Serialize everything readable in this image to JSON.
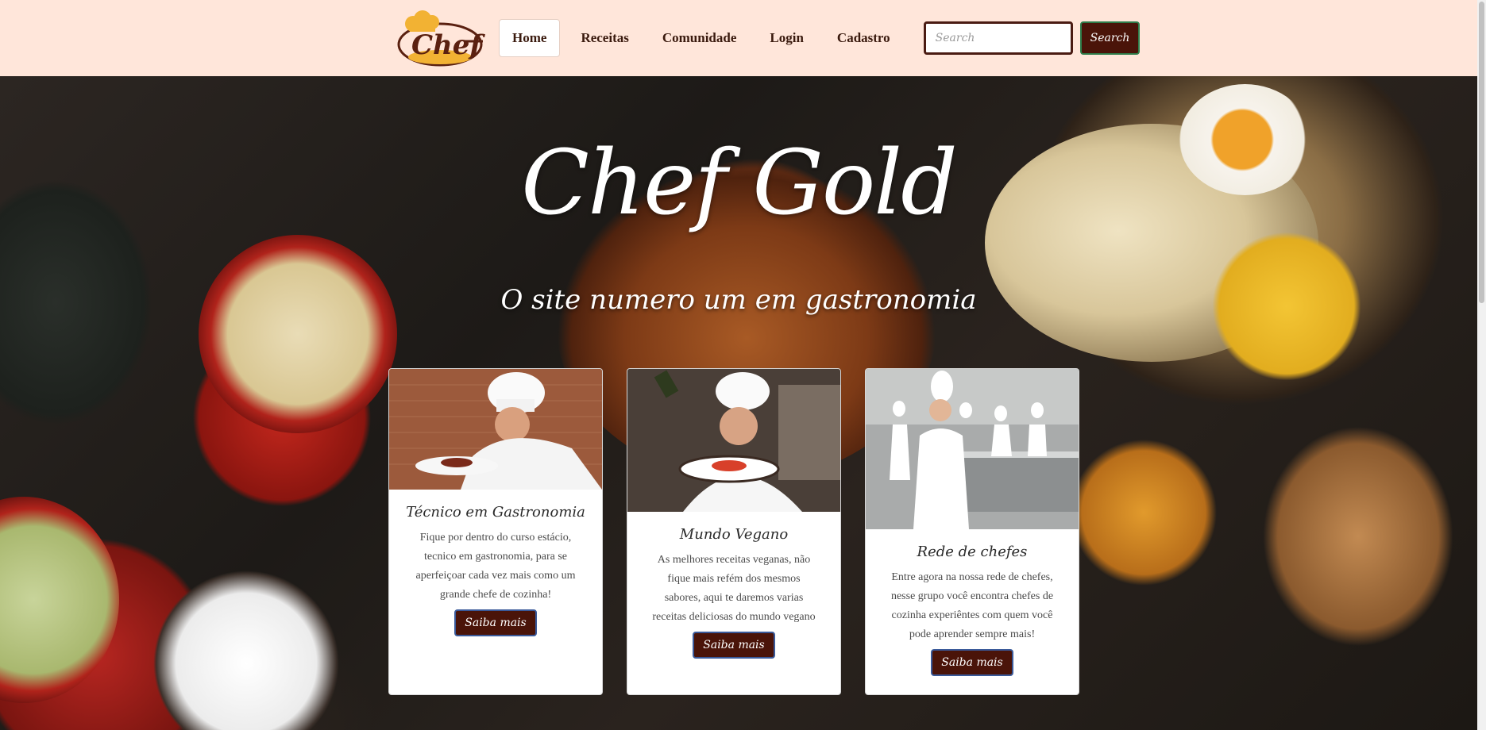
{
  "nav": {
    "logo_text": "Chef",
    "links": [
      "Home",
      "Receitas",
      "Comunidade",
      "Login",
      "Cadastro"
    ],
    "search_placeholder": "Search",
    "search_button": "Search"
  },
  "hero": {
    "title": "Chef Gold",
    "subtitle": "O site numero um em gastronomia"
  },
  "cards": [
    {
      "title": "Técnico em Gastronomia",
      "text": "Fique por dentro do curso estácio, tecnico em gastronomia, para se aperfeiçoar cada vez mais como um grande chefe de cozinha!",
      "button": "Saiba mais"
    },
    {
      "title": "Mundo Vegano",
      "text": "As melhores receitas veganas, não fique mais refém dos mesmos sabores, aqui te daremos varias receitas deliciosas do mundo vegano",
      "button": "Saiba mais"
    },
    {
      "title": "Rede de chefes",
      "text": "Entre agora na nossa rede de chefes, nesse grupo você encontra chefes de cozinha experiêntes com quem você pode aprender sempre mais!",
      "button": "Saiba mais"
    }
  ],
  "colors": {
    "nav_bg": "#ffe6da",
    "button_bg": "#4a1409",
    "text_dark": "#3a1a0e"
  }
}
